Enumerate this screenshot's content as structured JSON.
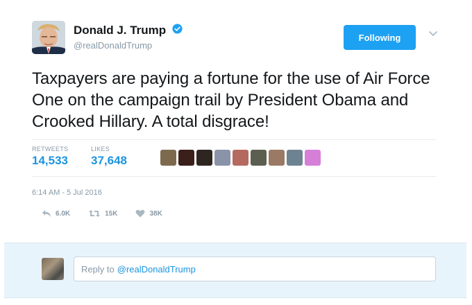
{
  "user": {
    "display_name": "Donald J. Trump",
    "handle": "@realDonaldTrump",
    "verified": true,
    "avatar_icon": "profile-photo"
  },
  "follow_button": {
    "label": "Following"
  },
  "tweet": {
    "text": "Taxpayers are paying a fortune for the use of Air Force One on the campaign trail by President Obama and Crooked Hillary. A total disgrace!",
    "timestamp": "6:14 AM - 5 Jul 2016"
  },
  "stats": {
    "retweets_label": "RETWEETS",
    "retweets_value": "14,533",
    "likes_label": "LIKES",
    "likes_value": "37,648"
  },
  "likers": [
    "#7d6a4e",
    "#3b1f1a",
    "#2f2520",
    "#8a93a8",
    "#b46a5f",
    "#5c5f4f",
    "#9a7a64",
    "#6d8391",
    "#d57fd8"
  ],
  "actions": [
    {
      "icon": "reply-icon",
      "count": "6.0K"
    },
    {
      "icon": "retweet-icon",
      "count": "15K"
    },
    {
      "icon": "heart-icon",
      "count": "38K"
    }
  ],
  "reply": {
    "placeholder_prefix": "Reply to",
    "placeholder_mention": "@realDonaldTrump"
  },
  "colors": {
    "accent": "#1da1f2",
    "link": "#1b95e0",
    "muted": "#8899a6",
    "reply_bg": "#e8f4fb"
  }
}
